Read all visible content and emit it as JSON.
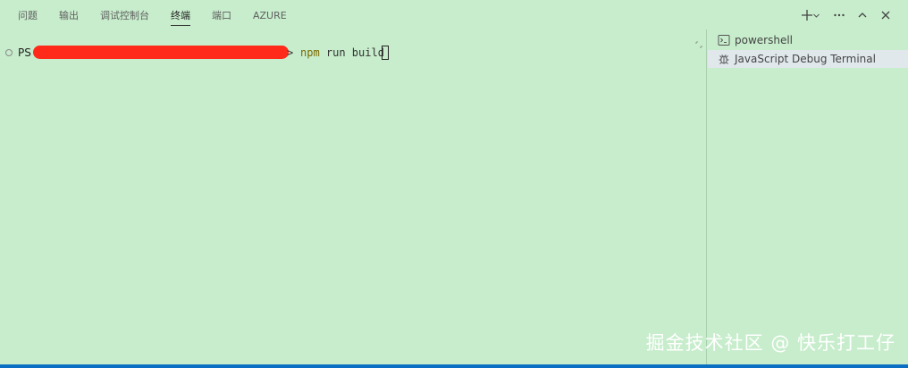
{
  "panel": {
    "tabs": [
      {
        "label": "问题"
      },
      {
        "label": "输出"
      },
      {
        "label": "调试控制台"
      },
      {
        "label": "终端",
        "active": true
      },
      {
        "label": "端口"
      },
      {
        "label": "AZURE"
      }
    ],
    "actions": [
      "plus-icon",
      "chevron-down-icon",
      "more-icon",
      "chevron-up-icon",
      "close-icon"
    ]
  },
  "terminal": {
    "prompt_prefix": "PS",
    "prompt_suffix": ">",
    "command": "npm",
    "command_args": " run build"
  },
  "terminal_list": {
    "items": [
      {
        "label": "powershell",
        "icon": "terminal-icon"
      },
      {
        "label": "JavaScript Debug Terminal",
        "icon": "debug-icon",
        "selected": true
      }
    ]
  },
  "watermark": "掘金技术社区 @ 快乐打工仔",
  "colors": {
    "background": "#c7edcc",
    "status_bar": "#0a6fc2",
    "redaction": "#ff2a1a",
    "selected_item": "#e0e8ec"
  }
}
